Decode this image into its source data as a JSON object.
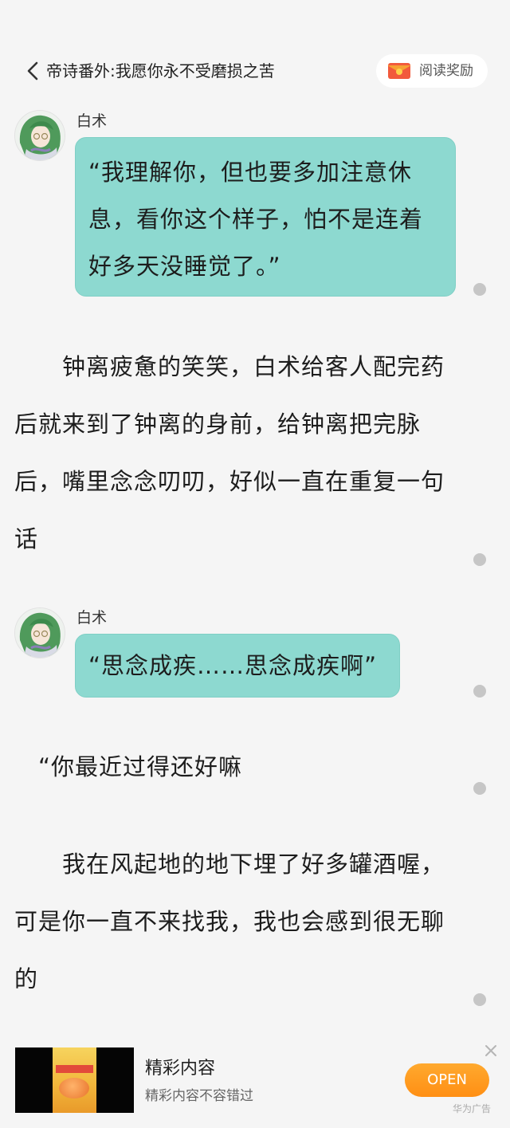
{
  "header": {
    "title": "帝诗番外:我愿你永不受磨损之苦",
    "reward_label": "阅读奖励",
    "back_icon": "chevron-left-icon",
    "reward_icon": "red-envelope-icon"
  },
  "messages": [
    {
      "speaker": "白术",
      "lines": [
        "“我理解你，但也要多加注意休",
        "息，看你这个样子，怕不是连着",
        "好多天没睡觉了。”"
      ]
    },
    {
      "speaker": "白术",
      "lines": [
        "“思念成疾……思念成疾啊”"
      ]
    }
  ],
  "paragraphs": [
    {
      "lines": [
        "　　钟离疲惫的笑笑，白术给客人配完药",
        "后就来到了钟离的身前，给钟离把完脉",
        "后，嘴里念念叨叨，好似一直在重复一句",
        "话"
      ]
    },
    {
      "lines": [
        "　“你最近过得还好嘛"
      ]
    },
    {
      "lines": [
        "　　我在风起地的地下埋了好多罐酒喔，",
        "可是你一直不来找我，我也会感到很无聊",
        "的"
      ]
    }
  ],
  "ad": {
    "title": "精彩内容",
    "subtitle": "精彩内容不容错过",
    "button": "OPEN",
    "brand": "华为广告",
    "close_icon": "close-icon"
  },
  "colors": {
    "background": "#f5f5f5",
    "bubble": "#8dd9d0",
    "button": "#ff9a1f"
  }
}
